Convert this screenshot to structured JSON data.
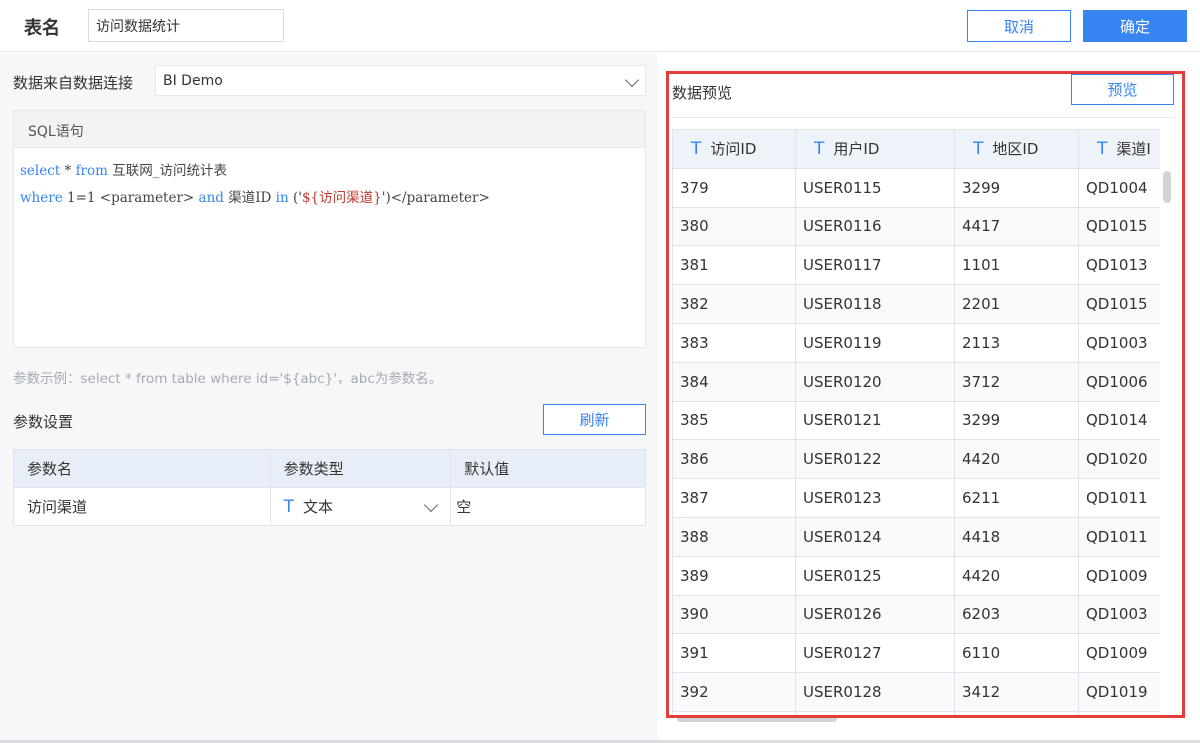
{
  "header": {
    "title_label": "表名",
    "table_name": "访问数据统计",
    "cancel_label": "取消",
    "ok_label": "确定"
  },
  "datasource": {
    "label": "数据来自数据连接",
    "selected": "BI Demo"
  },
  "sql": {
    "title": "SQL语句",
    "line1": {
      "kw1": "select",
      "star": " * ",
      "kw2": "from",
      "table": " 互联网_访问统计表"
    },
    "line2": {
      "kw1": "where",
      "cond": " 1=1 <parameter> ",
      "kw2": "and",
      "field": " 渠道ID ",
      "kw3": "in",
      "open": " ('",
      "str": "${访问渠道}",
      "close": "')</parameter>"
    }
  },
  "hint": "参数示例：select * from table where id='${abc}'，abc为参数名。",
  "params": {
    "title": "参数设置",
    "refresh_label": "刷新",
    "columns": [
      "参数名",
      "参数类型",
      "默认值"
    ],
    "rows": [
      {
        "name": "访问渠道",
        "type_icon": "T",
        "type": "文本",
        "default_placeholder": "空"
      }
    ]
  },
  "preview": {
    "title": "数据预览",
    "button_label": "预览",
    "column_icon": "T",
    "columns": [
      "访问ID",
      "用户ID",
      "地区ID",
      "渠道I"
    ],
    "rows": [
      [
        "379",
        "USER0115",
        "3299",
        "QD1004"
      ],
      [
        "380",
        "USER0116",
        "4417",
        "QD1015"
      ],
      [
        "381",
        "USER0117",
        "1101",
        "QD1013"
      ],
      [
        "382",
        "USER0118",
        "2201",
        "QD1015"
      ],
      [
        "383",
        "USER0119",
        "2113",
        "QD1003"
      ],
      [
        "384",
        "USER0120",
        "3712",
        "QD1006"
      ],
      [
        "385",
        "USER0121",
        "3299",
        "QD1014"
      ],
      [
        "386",
        "USER0122",
        "4420",
        "QD1020"
      ],
      [
        "387",
        "USER0123",
        "6211",
        "QD1011"
      ],
      [
        "388",
        "USER0124",
        "4418",
        "QD1011"
      ],
      [
        "389",
        "USER0125",
        "4420",
        "QD1009"
      ],
      [
        "390",
        "USER0126",
        "6203",
        "QD1003"
      ],
      [
        "391",
        "USER0127",
        "6110",
        "QD1009"
      ],
      [
        "392",
        "USER0128",
        "3412",
        "QD1019"
      ],
      [
        "",
        "",
        "",
        ""
      ]
    ]
  },
  "colors": {
    "primary": "#3685f2",
    "highlight": "#e43b3b"
  }
}
